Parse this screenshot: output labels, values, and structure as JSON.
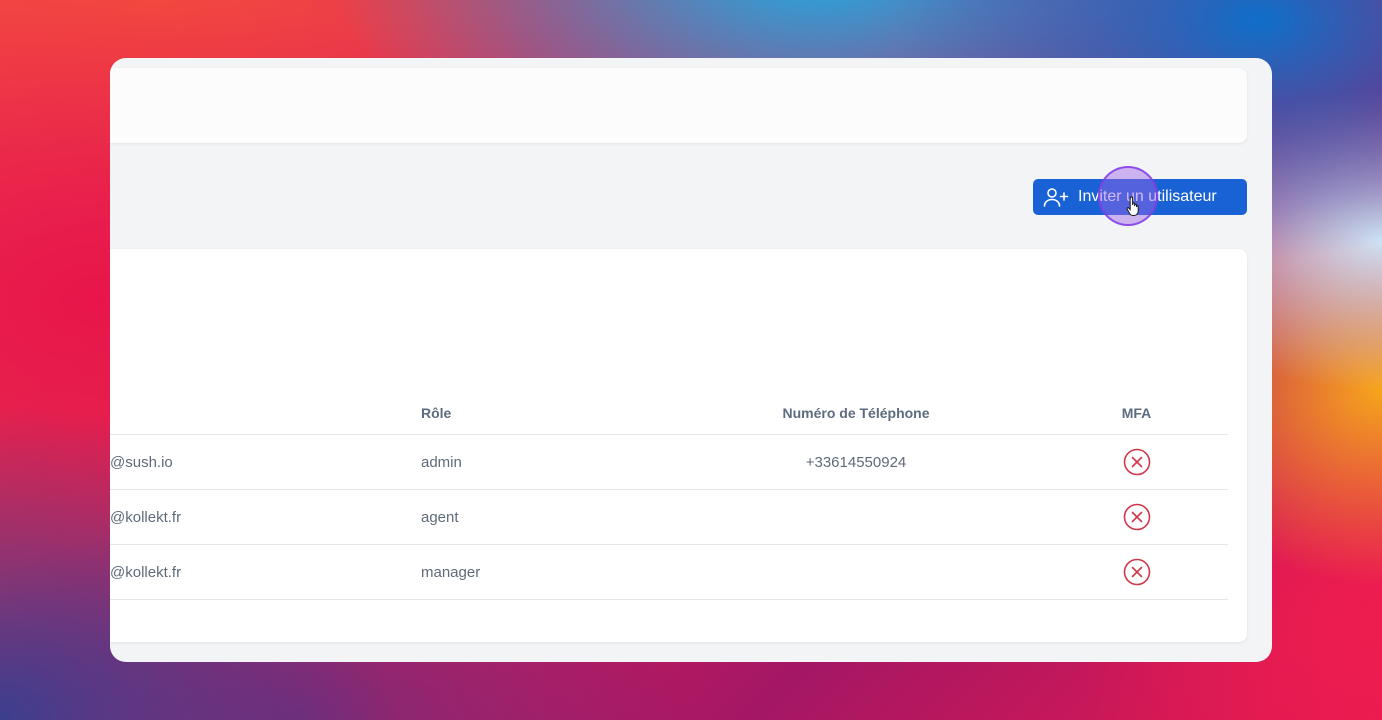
{
  "actions": {
    "invite_button_label": "Inviter un utilisateur"
  },
  "users_table": {
    "columns": {
      "email": "",
      "role": "Rôle",
      "phone": "Numéro de Téléphone",
      "mfa": "MFA"
    },
    "rows": [
      {
        "email": "@sush.io",
        "role": "admin",
        "phone": "+33614550924",
        "mfa_icon": "x-circle-icon",
        "mfa_enabled": false
      },
      {
        "email": "@kollekt.fr",
        "role": "agent",
        "phone": "",
        "mfa_icon": "x-circle-icon",
        "mfa_enabled": false
      },
      {
        "email": "@kollekt.fr",
        "role": "manager",
        "phone": "",
        "mfa_icon": "x-circle-icon",
        "mfa_enabled": false
      }
    ]
  },
  "icons": {
    "invite": "user-plus-icon",
    "mfa_disabled": "x-circle-icon"
  },
  "colors": {
    "primary": "#1862d6",
    "mfa_disabled": "#d0374a",
    "cursor_highlight": "#9e64e8"
  }
}
